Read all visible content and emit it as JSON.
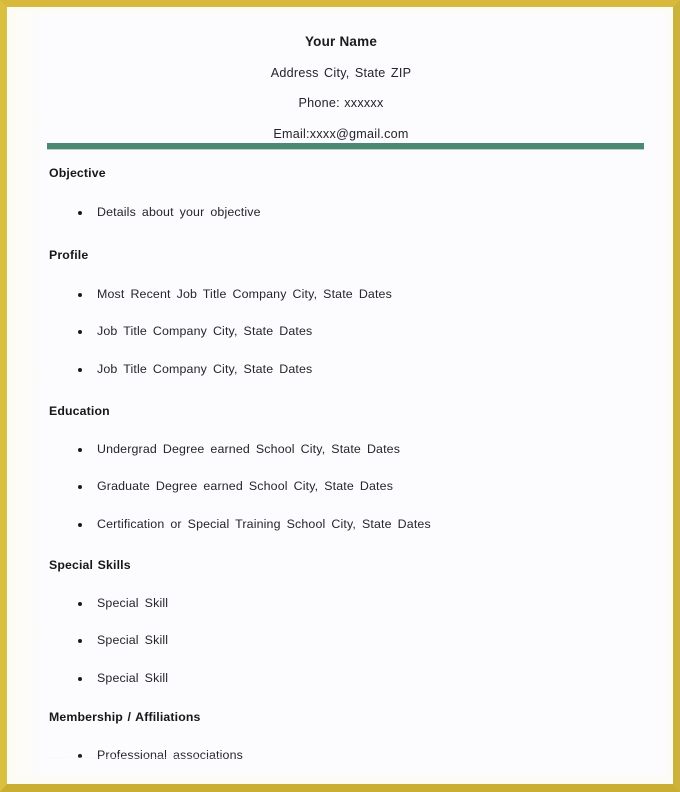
{
  "document": {
    "type": "resume-template",
    "frame_color": "#d4b63c",
    "page_color": "#fcfbfd",
    "divider_color": "#4a8a72",
    "text_color": "#25252b"
  },
  "header": {
    "name": "Your Name",
    "address": "Address City, State ZIP",
    "phone": "Phone: xxxxxx",
    "email": "Email:xxxx@gmail.com"
  },
  "sections": [
    {
      "id": "objective",
      "heading": "Objective",
      "items": [
        "Details about your objective"
      ]
    },
    {
      "id": "profile",
      "heading": "Profile",
      "items": [
        "Most Recent Job Title   Company   City, State   Dates",
        "Job Title   Company   City, State   Dates",
        "Job Title   Company   City, State   Dates"
      ]
    },
    {
      "id": "education",
      "heading": "Education",
      "items": [
        "Undergrad Degree earned  School  City, State   Dates",
        "Graduate Degree earned  School  City, State   Dates",
        "Certification or Special Training  School  City, State   Dates"
      ]
    },
    {
      "id": "special-skills",
      "heading": "Special Skills",
      "items": [
        "Special Skill",
        "Special Skill",
        "Special Skill"
      ]
    },
    {
      "id": "membership",
      "heading": "Membership / Affiliations",
      "items": [
        "Professional associations"
      ]
    }
  ],
  "watermark": {
    "text": "—— ——— ———— ——— ———— ——"
  }
}
